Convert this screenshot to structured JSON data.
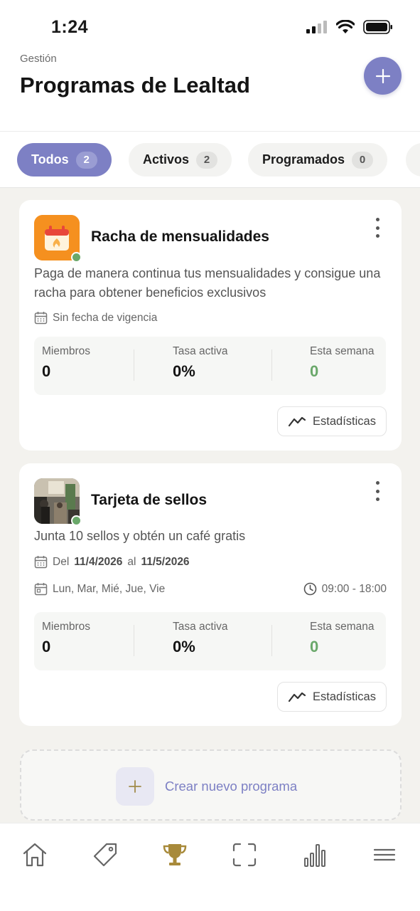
{
  "status_bar": {
    "time": "1:24"
  },
  "header": {
    "eyebrow": "Gestión",
    "title": "Programas de Lealtad",
    "fab_icon": "plus-icon"
  },
  "tabs": [
    {
      "label": "Todos",
      "count": "2",
      "active": true
    },
    {
      "label": "Activos",
      "count": "2",
      "active": false
    },
    {
      "label": "Programados",
      "count": "0",
      "active": false
    }
  ],
  "programs": [
    {
      "title": "Racha de mensualidades",
      "description": "Paga de manera continua tus mensualidades y consigue una racha para obtener beneficios exclusivos",
      "validity": "Sin fecha de vigencia",
      "icon": "calendar-streak-icon",
      "status": "active",
      "stats": {
        "members_label": "Miembros",
        "members_value": "0",
        "rate_label": "Tasa activa",
        "rate_value": "0%",
        "week_label": "Esta semana",
        "week_value": "0"
      },
      "stats_button": "Estadísticas"
    },
    {
      "title": "Tarjeta de sellos",
      "description": "Junta 10 sellos y obtén un café gratis",
      "date_prefix": "Del",
      "date_from": "11/4/2026",
      "date_mid": "al",
      "date_to": "11/5/2026",
      "days": "Lun, Mar, Mié, Jue, Vie",
      "hours": "09:00 - 18:00",
      "icon": "cafe-photo",
      "status": "active",
      "stats": {
        "members_label": "Miembros",
        "members_value": "0",
        "rate_label": "Tasa activa",
        "rate_value": "0%",
        "week_label": "Esta semana",
        "week_value": "0"
      },
      "stats_button": "Estadísticas"
    }
  ],
  "create_program": {
    "label": "Crear nuevo programa"
  },
  "bottom_nav": [
    "home-icon",
    "tag-icon",
    "trophy-icon",
    "scan-icon",
    "chart-icon",
    "menu-icon"
  ],
  "colors": {
    "accent": "#7d80c4",
    "success": "#6aa86a",
    "trophy": "#a88a3a"
  }
}
